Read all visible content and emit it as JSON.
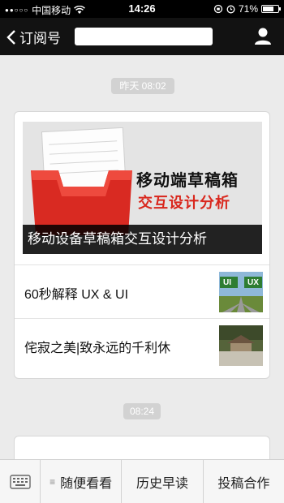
{
  "status_bar": {
    "signal": "●●○○○",
    "carrier": "中国移动",
    "time": "14:26",
    "battery": "71%",
    "battery_level": 0.71
  },
  "nav": {
    "back_label": "订阅号"
  },
  "feed": {
    "timestamp_1": "昨天 08:02",
    "timestamp_2": "08:24",
    "cover": {
      "image_line_1": "移动端草稿箱",
      "image_line_2": "交互设计分析",
      "caption": "移动设备草稿箱交互设计分析"
    },
    "articles": [
      {
        "title": "60秒解释 UX & UI",
        "thumb_left": "UI",
        "thumb_right": "UX"
      },
      {
        "title": "侘寂之美|致永远的千利休"
      }
    ]
  },
  "bottom_menu": {
    "items": [
      "随便看看",
      "历史早读",
      "投稿合作"
    ]
  },
  "colors": {
    "accent_red": "#d9261c",
    "nav_bg": "#121212",
    "chat_bg": "#ebebeb"
  }
}
